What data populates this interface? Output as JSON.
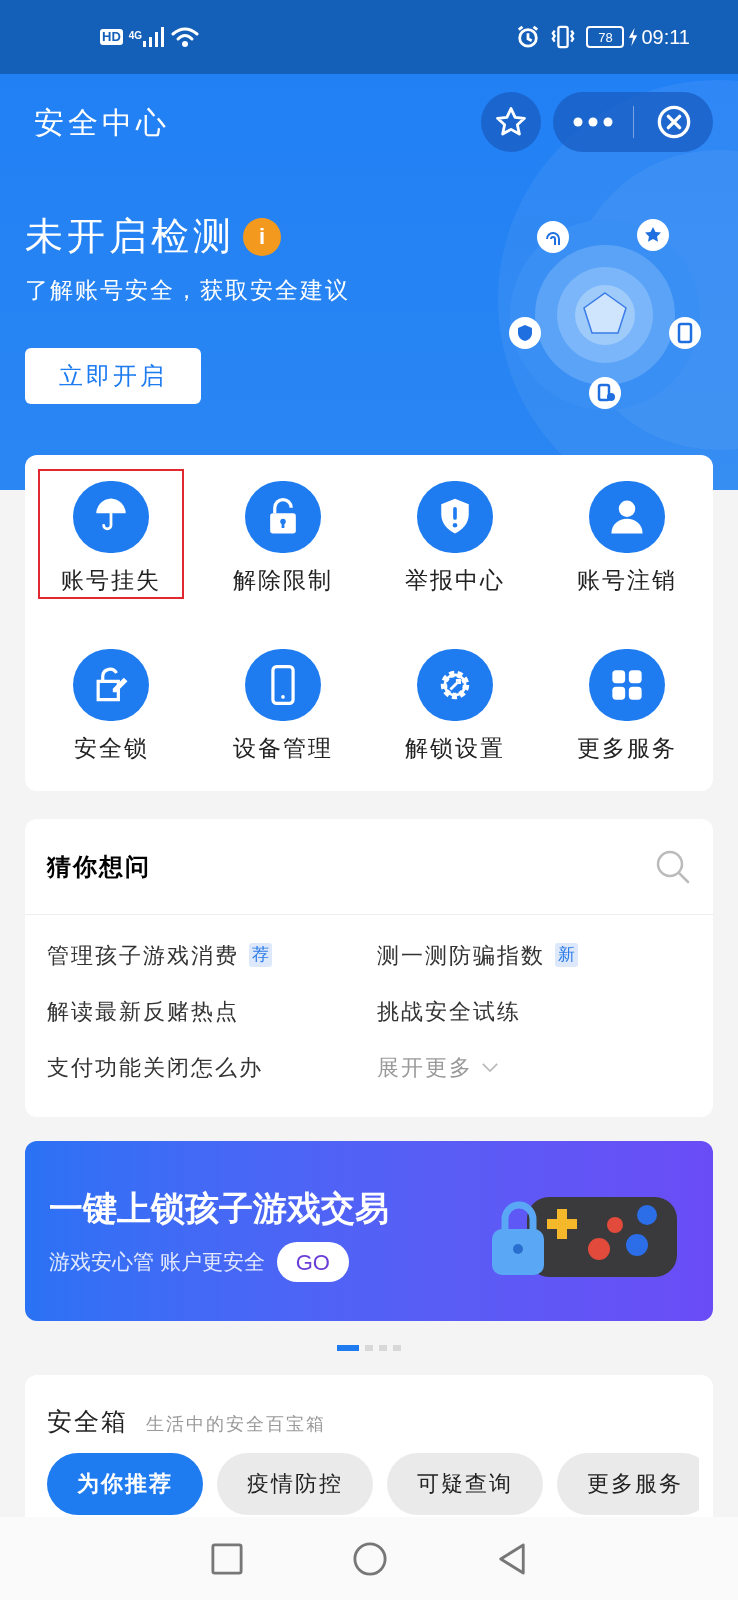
{
  "status_bar": {
    "hd": "HD",
    "network": "4G",
    "battery": "78",
    "time": "09:11"
  },
  "header": {
    "title": "安全中心"
  },
  "hero": {
    "title": "未开启检测",
    "info": "i",
    "subtitle": "了解账号安全，获取安全建议",
    "button": "立即开启"
  },
  "services": [
    {
      "label": "账号挂失",
      "kind": "umbrella",
      "highlighted": true
    },
    {
      "label": "解除限制",
      "kind": "unlock",
      "highlighted": false
    },
    {
      "label": "举报中心",
      "kind": "shield",
      "highlighted": false
    },
    {
      "label": "账号注销",
      "kind": "person",
      "highlighted": false
    },
    {
      "label": "安全锁",
      "kind": "lockpen",
      "highlighted": false
    },
    {
      "label": "设备管理",
      "kind": "phone",
      "highlighted": false
    },
    {
      "label": "解锁设置",
      "kind": "gear",
      "highlighted": false
    },
    {
      "label": "更多服务",
      "kind": "grid",
      "highlighted": false
    }
  ],
  "questions": {
    "title": "猜你想问",
    "items": [
      {
        "text": "管理孩子游戏消费",
        "tag": "荐"
      },
      {
        "text": "测一测防骗指数",
        "tag": "新"
      },
      {
        "text": "解读最新反赌热点"
      },
      {
        "text": "挑战安全试练"
      },
      {
        "text": "支付功能关闭怎么办"
      }
    ],
    "more": "展开更多"
  },
  "banner": {
    "title": "一键上锁孩子游戏交易",
    "subtitle": "游戏安心管 账户更安全",
    "button": "GO"
  },
  "carousel_dots": [
    {
      "selected": true
    },
    {
      "selected": false
    },
    {
      "selected": false
    },
    {
      "selected": false
    }
  ],
  "toolbox": {
    "title": "安全箱",
    "subtitle": "生活中的安全百宝箱",
    "tabs": [
      {
        "label": "为你推荐",
        "selected": true
      },
      {
        "label": "疫情防控",
        "selected": false
      },
      {
        "label": "可疑查询",
        "selected": false
      },
      {
        "label": "更多服务",
        "selected": false
      }
    ]
  }
}
